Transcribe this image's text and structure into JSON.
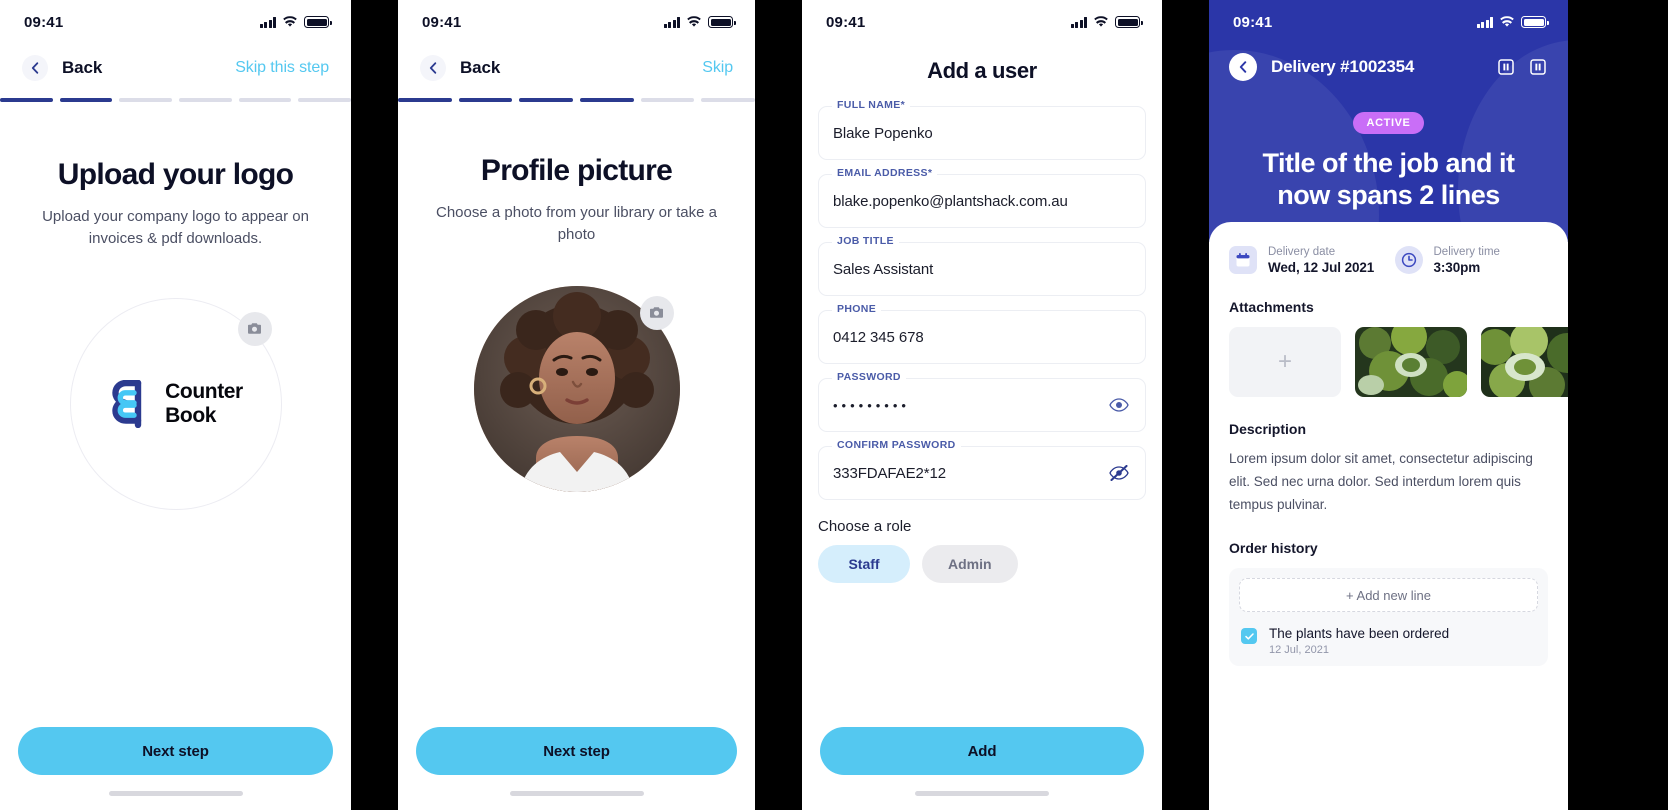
{
  "screens": [
    {
      "status": {
        "time": "09:41"
      },
      "nav": {
        "back_label": "Back",
        "skip_label": "Skip this step"
      },
      "progress": {
        "total": 6,
        "filled": 2
      },
      "title": "Upload your logo",
      "subtitle": "Upload your company logo to appear on invoices & pdf downloads.",
      "logo": {
        "line1": "Counter",
        "line2": "Book",
        "camera_icon": "camera-icon"
      },
      "cta": "Next step"
    },
    {
      "status": {
        "time": "09:41"
      },
      "nav": {
        "back_label": "Back",
        "skip_label": "Skip"
      },
      "progress": {
        "total": 6,
        "filled": 4
      },
      "title": "Profile picture",
      "subtitle": "Choose a photo from your library or take a photo",
      "camera_icon": "camera-icon",
      "cta": "Next step"
    },
    {
      "status": {
        "time": "09:41"
      },
      "title": "Add a user",
      "fields": [
        {
          "label": "FULL NAME*",
          "value": "Blake Popenko",
          "type": "text"
        },
        {
          "label": "EMAIL ADDRESS*",
          "value": "blake.popenko@plantshack.com.au",
          "type": "text"
        },
        {
          "label": "JOB TITLE",
          "value": "Sales Assistant",
          "type": "text"
        },
        {
          "label": "PHONE",
          "value": "0412 345 678",
          "type": "text"
        },
        {
          "label": "PASSWORD",
          "value": "•••••••••",
          "type": "password",
          "icon": "eye-icon"
        },
        {
          "label": "CONFIRM PASSWORD",
          "value": "333FDAFAE2*12",
          "type": "text",
          "icon": "eye-off-icon"
        }
      ],
      "role_label": "Choose a role",
      "roles": [
        {
          "label": "Staff",
          "selected": true
        },
        {
          "label": "Admin",
          "selected": false
        }
      ],
      "cta": "Add"
    },
    {
      "status": {
        "time": "09:41"
      },
      "hero": {
        "back_icon": "chevron-left-icon",
        "title": "Delivery #1002354",
        "icons": [
          "pause-icon",
          "stop-icon"
        ],
        "badge": "ACTIVE",
        "heading": "Title of the job and it now spans 2 lines"
      },
      "meta": [
        {
          "icon": "calendar-icon",
          "key": "Delivery date",
          "value": "Wed, 12 Jul 2021"
        },
        {
          "icon": "clock-icon",
          "key": "Delivery time",
          "value": "3:30pm"
        }
      ],
      "attachments_heading": "Attachments",
      "attachments_add": "+",
      "description_heading": "Description",
      "description": "Lorem ipsum dolor sit amet, consectetur adipiscing elit. Sed nec urna dolor. Sed interdum lorem quis tempus pulvinar.",
      "order_history_heading": "Order history",
      "add_new_line": "+ Add new line",
      "history": [
        {
          "text": "The plants have been ordered",
          "date": "12 Jul, 2021"
        }
      ]
    }
  ],
  "colors": {
    "accent_blue": "#54c8f0",
    "deep_blue": "#2b36a8",
    "progress_on": "#2b3a8f",
    "badge_purple": "#c96ef7",
    "label_blue": "#4a5ba8"
  }
}
